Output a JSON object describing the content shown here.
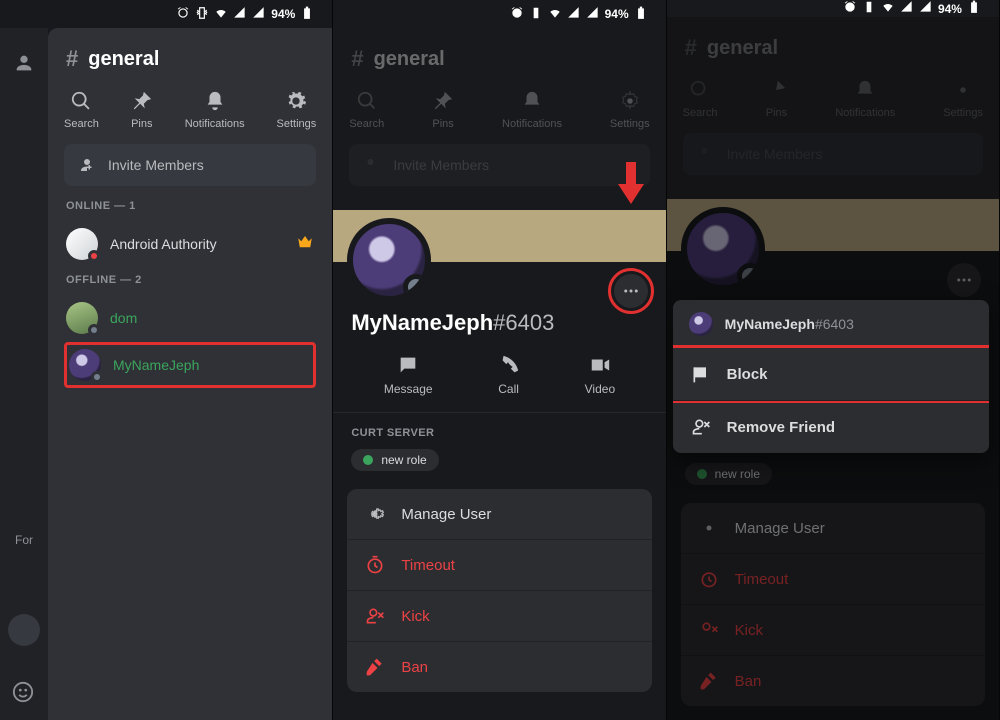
{
  "status_bar": {
    "battery_pct": "94%"
  },
  "panel1": {
    "channel_name": "general",
    "actions": {
      "search": "Search",
      "pins": "Pins",
      "notifications": "Notifications",
      "settings": "Settings"
    },
    "invite_label": "Invite Members",
    "online_label": "ONLINE — 1",
    "offline_label": "OFFLINE — 2",
    "members": {
      "android_authority": "Android Authority",
      "dom": "dom",
      "mynamejeph": "MyNameJeph"
    },
    "rail_for": "For"
  },
  "panel2": {
    "channel_name": "general",
    "actions": {
      "search": "Search",
      "pins": "Pins",
      "notifications": "Notifications",
      "settings": "Settings"
    },
    "invite_label": "Invite Members",
    "user": {
      "name": "MyNameJeph",
      "tag": "#6403"
    },
    "comm": {
      "message": "Message",
      "call": "Call",
      "video": "Video"
    },
    "server_label": "CURT SERVER",
    "role": "new role",
    "card": {
      "manage": "Manage User",
      "timeout": "Timeout",
      "kick": "Kick",
      "ban": "Ban"
    }
  },
  "panel3": {
    "channel_name": "general",
    "actions": {
      "search": "Search",
      "pins": "Pins",
      "notifications": "Notifications",
      "settings": "Settings"
    },
    "invite_label": "Invite Members",
    "user": {
      "name": "MyNameJeph",
      "tag": "#6403"
    },
    "role": "new role",
    "card": {
      "manage": "Manage User",
      "timeout": "Timeout",
      "kick": "Kick",
      "ban": "Ban"
    },
    "menu": {
      "block": "Block",
      "remove": "Remove Friend"
    }
  }
}
